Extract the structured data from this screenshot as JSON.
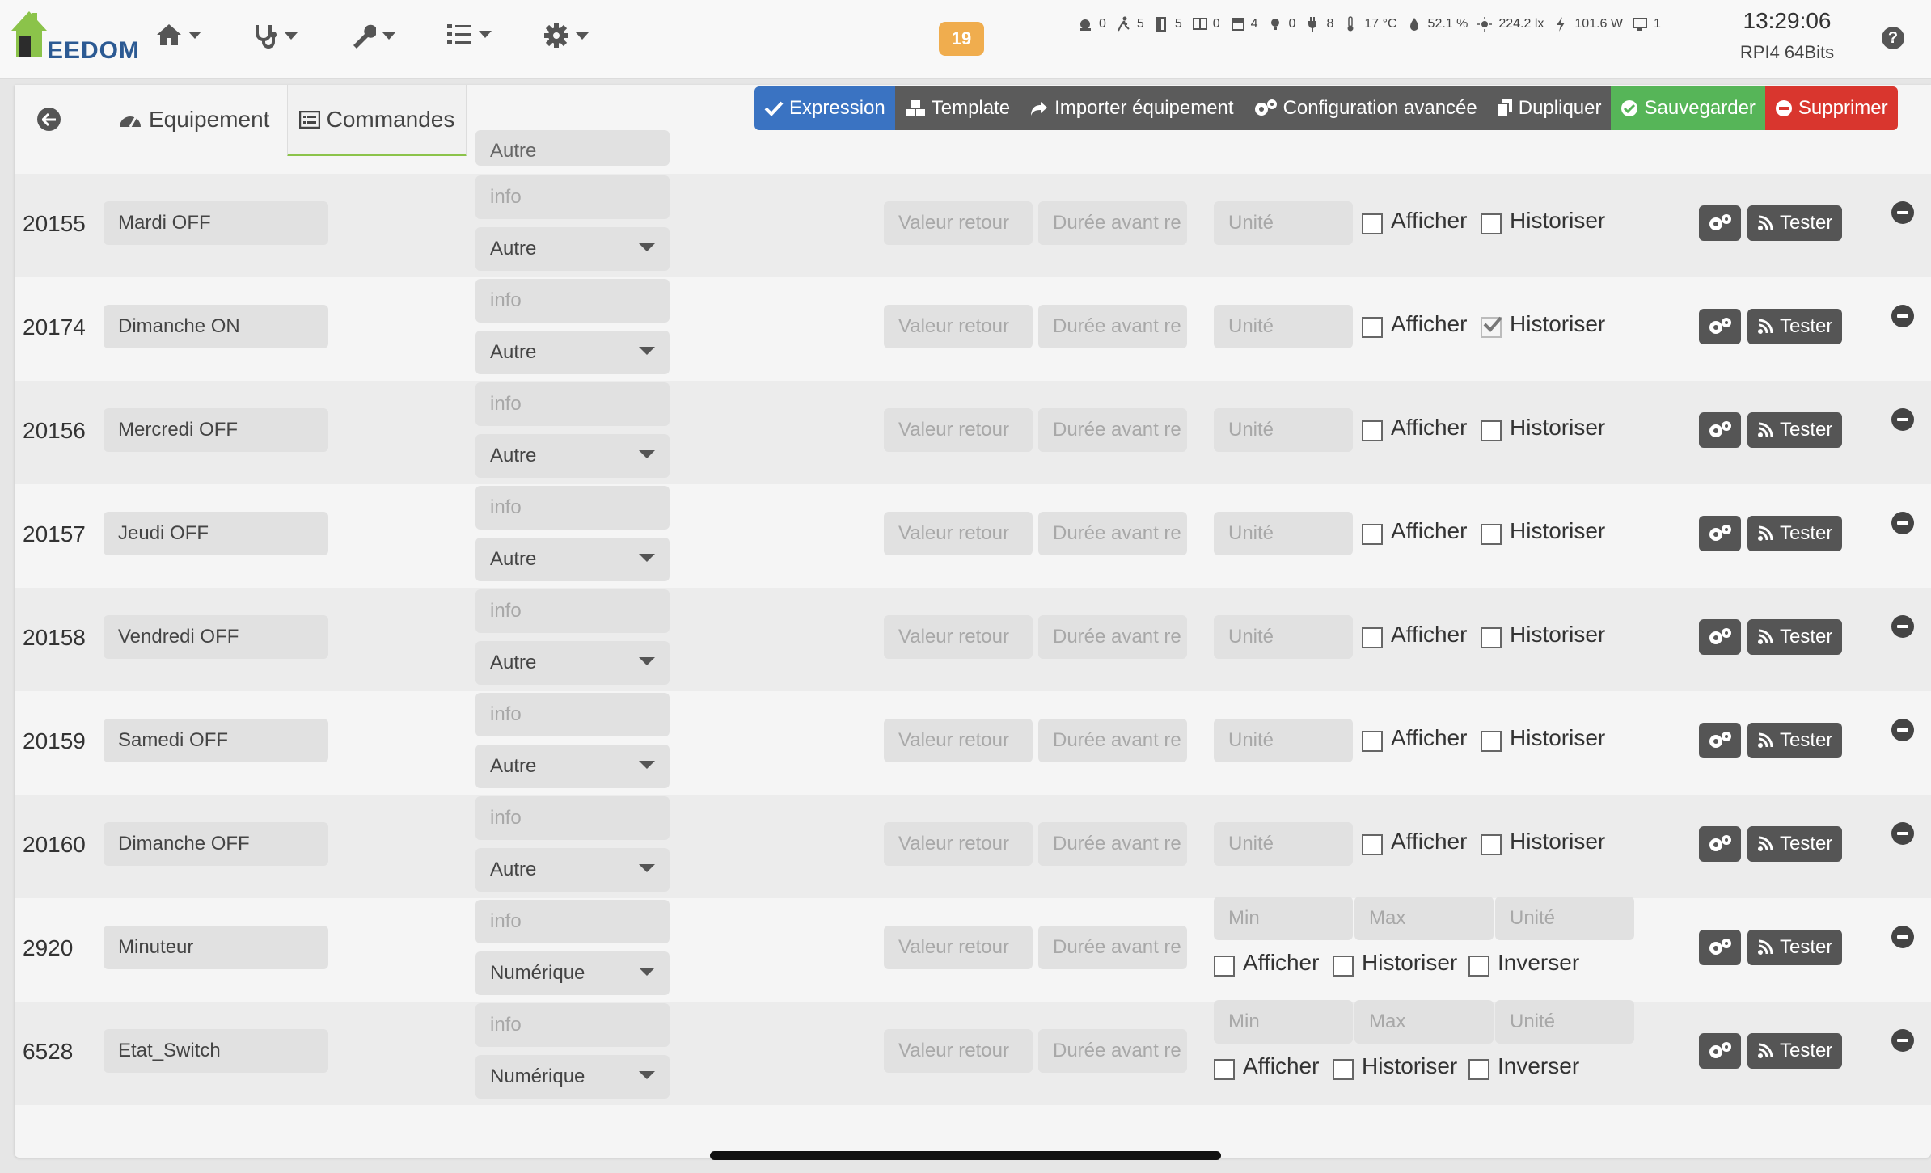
{
  "app": {
    "logo_text": "EEDOM"
  },
  "header": {
    "messages_count": "19",
    "clock": "13:29:06",
    "host": "RPI4 64Bits",
    "summary": [
      {
        "icon": "alarm-icon",
        "value": "0"
      },
      {
        "icon": "motion-icon",
        "value": "5"
      },
      {
        "icon": "door-icon",
        "value": "5"
      },
      {
        "icon": "window-icon",
        "value": "0"
      },
      {
        "icon": "shutter-icon",
        "value": "4"
      },
      {
        "icon": "light-icon",
        "value": "0"
      },
      {
        "icon": "plug-icon",
        "value": "8"
      },
      {
        "icon": "thermometer-icon",
        "value": "17 °C"
      },
      {
        "icon": "humidity-icon",
        "value": "52.1 %"
      },
      {
        "icon": "luminosity-icon",
        "value": "224.2 lx"
      },
      {
        "icon": "power-icon",
        "value": "101.6 W"
      },
      {
        "icon": "screen-icon",
        "value": "1"
      }
    ]
  },
  "tabs": {
    "equipment": "Equipement",
    "commands": "Commandes"
  },
  "actions": {
    "expression": "Expression",
    "template": "Template",
    "import": "Importer équipement",
    "advanced": "Configuration avancée",
    "duplicate": "Dupliquer",
    "save": "Sauvegarder",
    "delete": "Supprimer"
  },
  "placeholders": {
    "subtype": "info",
    "return_value": "Valeur retour",
    "delay": "Durée avant re",
    "unit": "Unité",
    "min": "Min",
    "max": "Max"
  },
  "labels": {
    "show": "Afficher",
    "historize": "Historiser",
    "invert": "Inverser",
    "test": "Tester"
  },
  "partial_row_type": "Autre",
  "commands": [
    {
      "id": "20155",
      "name": "Mardi OFF",
      "type": "Autre",
      "historize": false
    },
    {
      "id": "20174",
      "name": "Dimanche ON",
      "type": "Autre",
      "historize": true
    },
    {
      "id": "20156",
      "name": "Mercredi OFF",
      "type": "Autre",
      "historize": false
    },
    {
      "id": "20157",
      "name": "Jeudi OFF",
      "type": "Autre",
      "historize": false
    },
    {
      "id": "20158",
      "name": "Vendredi OFF",
      "type": "Autre",
      "historize": false
    },
    {
      "id": "20159",
      "name": "Samedi OFF",
      "type": "Autre",
      "historize": false
    },
    {
      "id": "20160",
      "name": "Dimanche OFF",
      "type": "Autre",
      "historize": false
    },
    {
      "id": "2920",
      "name": "Minuteur",
      "type": "Numérique",
      "historize": false,
      "numeric": true
    },
    {
      "id": "6528",
      "name": "Etat_Switch",
      "type": "Numérique",
      "historize": false,
      "numeric": true
    }
  ],
  "colors": {
    "accent_blue": "#3a73c2",
    "save_green": "#56b558",
    "delete_red": "#d9362e",
    "badge_orange": "#f0ad4e"
  }
}
